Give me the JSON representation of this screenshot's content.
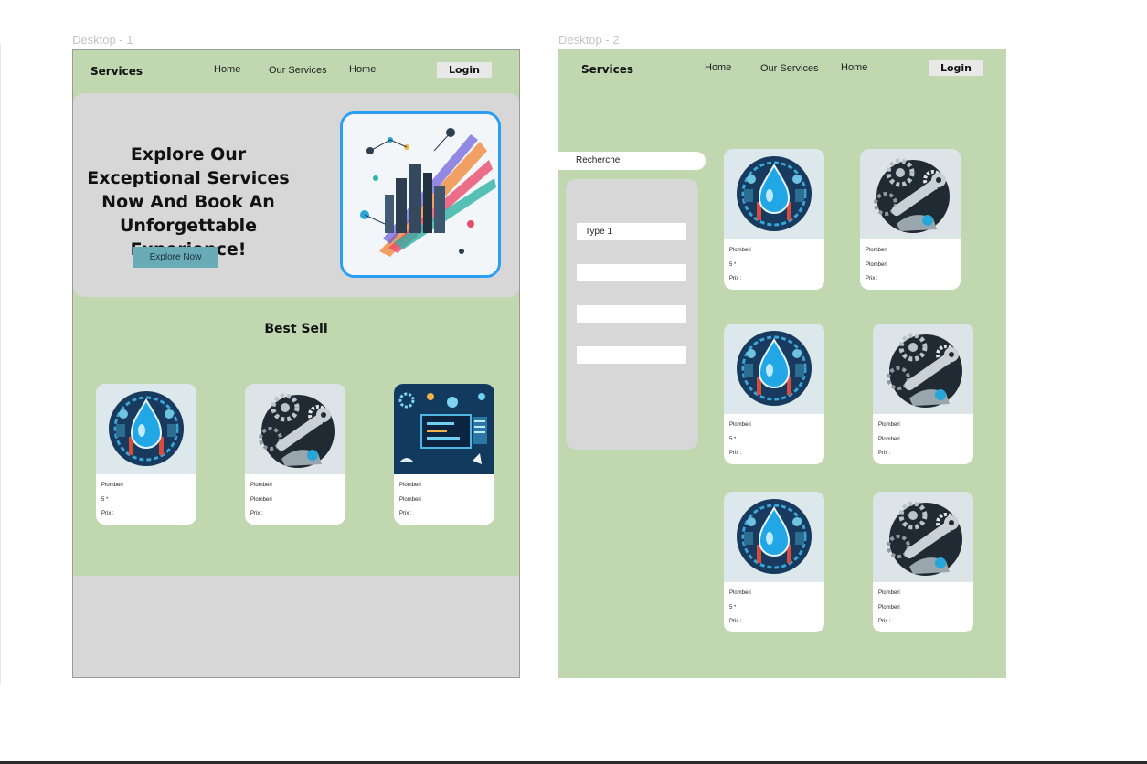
{
  "canvas": {
    "frame1_label": "Desktop - 1",
    "frame2_label": "Desktop - 2"
  },
  "desktop1": {
    "nav": {
      "brand": "Services",
      "links": [
        "Home",
        "Our Services",
        "Home"
      ],
      "login": "Login"
    },
    "hero": {
      "title": "Explore Our Exceptional Services Now And Book An Unforgettable Experience!",
      "cta": "Explore Now",
      "image": "abstract-city-illustration"
    },
    "best_sell": {
      "title": "Best Sell",
      "cards": [
        {
          "image": "plumbing-water-drop-icon",
          "lines": [
            "Plomberi",
            "5 *",
            "Prix :"
          ]
        },
        {
          "image": "mechanic-gears-wrench-icon",
          "lines": [
            "Plomberi",
            "Plomberi",
            "Prix :"
          ]
        },
        {
          "image": "tech-dashboard-icon",
          "lines": [
            "Plomberi",
            "Plomberi",
            "Prix :"
          ]
        }
      ]
    }
  },
  "desktop2": {
    "nav": {
      "brand": "Services",
      "links": [
        "Home",
        "Our Services",
        "Home"
      ],
      "login": "Login"
    },
    "search": {
      "label": "Recherche"
    },
    "filters": [
      "Type 1",
      "",
      "",
      ""
    ],
    "cards": [
      {
        "image": "plumbing-water-drop-icon",
        "lines": [
          "Plomberi",
          "5 *",
          "Prix :"
        ]
      },
      {
        "image": "mechanic-gears-wrench-icon",
        "lines": [
          "Plomberi",
          "Plomberi",
          "Prix :"
        ]
      },
      {
        "image": "plumbing-water-drop-icon",
        "lines": [
          "Plomberi",
          "5 *",
          "Prix :"
        ]
      },
      {
        "image": "mechanic-gears-wrench-icon",
        "lines": [
          "Plomberi",
          "Plomberi",
          "Prix :"
        ]
      },
      {
        "image": "plumbing-water-drop-icon",
        "lines": [
          "Plomberi",
          "5 *",
          "Prix :"
        ]
      },
      {
        "image": "mechanic-gears-wrench-icon",
        "lines": [
          "Plomberi",
          "Plomberi",
          "Prix :"
        ]
      }
    ]
  },
  "colors": {
    "frame_bg": "#c0d7b0",
    "panel_gray": "#d7d7d7",
    "button_teal": "#6aabb8",
    "hero_border": "#2b9ef2"
  }
}
